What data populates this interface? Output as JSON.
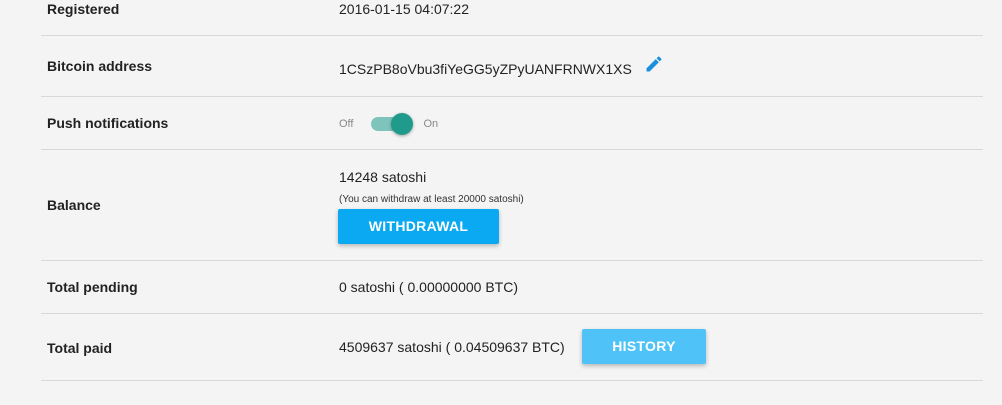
{
  "rows": {
    "registered": {
      "label": "Registered",
      "value": "2016-01-15 04:07:22"
    },
    "bitcoin": {
      "label": "Bitcoin address",
      "value": "1CSzPB8oVbu3fiYeGG5yZPyUANFRNWX1XS",
      "edit_icon": "pencil-icon"
    },
    "push": {
      "label": "Push notifications",
      "off_label": "Off",
      "on_label": "On",
      "state": "on"
    },
    "balance": {
      "label": "Balance",
      "amount": "14248 satoshi",
      "note": "(You can withdraw at least 20000 satoshi)",
      "button": "WITHDRAWAL"
    },
    "pending": {
      "label": "Total pending",
      "value": "0 satoshi ( 0.00000000 BTC)"
    },
    "paid": {
      "label": "Total paid",
      "value": "4509637 satoshi ( 0.04509637 BTC)",
      "button": "HISTORY"
    }
  },
  "colors": {
    "withdraw_button": "#0aa9f1",
    "history_button": "#4fc3f7",
    "toggle_knob": "#1e9b8a",
    "edit_icon": "#1a8fe0"
  }
}
